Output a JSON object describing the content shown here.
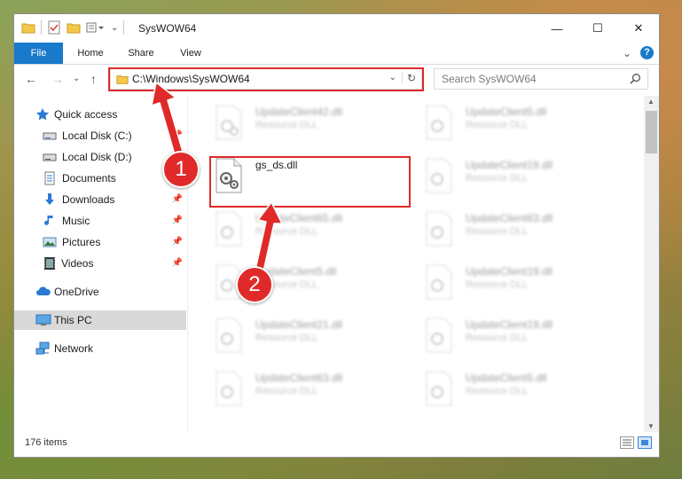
{
  "window": {
    "title": "SysWOW64",
    "controls": {
      "minimize": "—",
      "maximize": "☐",
      "close": "✕"
    }
  },
  "ribbon": {
    "tabs": [
      "File",
      "Home",
      "Share",
      "View"
    ],
    "collapse": "⌄",
    "help": "?"
  },
  "nav": {
    "back": "←",
    "forward": "→",
    "recent": "⌄",
    "up": "↑",
    "address": "C:\\Windows\\SysWOW64",
    "address_dropdown": "⌄",
    "refresh": "↻",
    "search_placeholder": "Search SysWOW64"
  },
  "sidebar": {
    "items": [
      {
        "label": "Quick access",
        "icon": "star-icon",
        "pinned": false
      },
      {
        "label": "Local Disk (C:)",
        "icon": "drive-icon",
        "pinned": true
      },
      {
        "label": "Local Disk (D:)",
        "icon": "drive-icon",
        "pinned": true
      },
      {
        "label": "Documents",
        "icon": "documents-icon",
        "pinned": true
      },
      {
        "label": "Downloads",
        "icon": "download-icon",
        "pinned": true
      },
      {
        "label": "Music",
        "icon": "music-icon",
        "pinned": true
      },
      {
        "label": "Pictures",
        "icon": "pictures-icon",
        "pinned": true
      },
      {
        "label": "Videos",
        "icon": "videos-icon",
        "pinned": true
      },
      {
        "label": "OneDrive",
        "icon": "cloud-icon",
        "pinned": false
      },
      {
        "label": "This PC",
        "icon": "computer-icon",
        "pinned": false,
        "selected": true
      },
      {
        "label": "Network",
        "icon": "network-icon",
        "pinned": false
      }
    ],
    "pin_glyph": "📌"
  },
  "files": {
    "col1": [
      {
        "name": "UpdateClient42.dll",
        "type": "Resource DLL"
      },
      {
        "name": "gs_ds.dll",
        "type": ""
      },
      {
        "name": "UpdateClient65.dll",
        "type": "Resource DLL"
      },
      {
        "name": "UpdateClient5.dll",
        "type": "Resource DLL"
      },
      {
        "name": "UpdateClient21.dll",
        "type": "Resource DLL"
      },
      {
        "name": "UpdateClient63.dll",
        "type": "Resource DLL"
      }
    ],
    "col2": [
      {
        "name": "UpdateClient5.dll",
        "type": "Resource DLL"
      },
      {
        "name": "UpdateClient19.dll",
        "type": "Resource DLL"
      },
      {
        "name": "UpdateClient63.dll",
        "type": "Resource DLL"
      },
      {
        "name": "UpdateClient19.dll",
        "type": "Resource DLL"
      },
      {
        "name": "UpdateClient19.dll",
        "type": "Resource DLL"
      },
      {
        "name": "UpdateClient5.dll",
        "type": "Resource DLL"
      }
    ]
  },
  "status": {
    "item_count": "176 items"
  },
  "callouts": {
    "one": "1",
    "two": "2"
  },
  "colors": {
    "accent": "#1979ca",
    "highlight": "#e02a2a"
  }
}
